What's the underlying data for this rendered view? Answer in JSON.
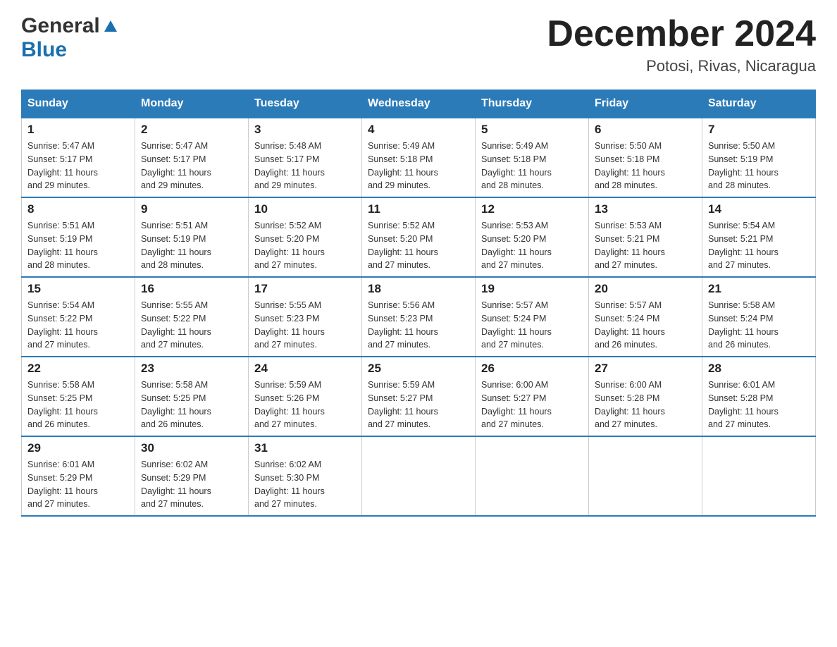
{
  "header": {
    "logo": {
      "general": "General",
      "blue": "Blue",
      "tagline": ""
    },
    "title": "December 2024",
    "location": "Potosi, Rivas, Nicaragua"
  },
  "days_of_week": [
    "Sunday",
    "Monday",
    "Tuesday",
    "Wednesday",
    "Thursday",
    "Friday",
    "Saturday"
  ],
  "weeks": [
    [
      {
        "day": "1",
        "sunrise": "5:47 AM",
        "sunset": "5:17 PM",
        "daylight": "11 hours and 29 minutes."
      },
      {
        "day": "2",
        "sunrise": "5:47 AM",
        "sunset": "5:17 PM",
        "daylight": "11 hours and 29 minutes."
      },
      {
        "day": "3",
        "sunrise": "5:48 AM",
        "sunset": "5:17 PM",
        "daylight": "11 hours and 29 minutes."
      },
      {
        "day": "4",
        "sunrise": "5:49 AM",
        "sunset": "5:18 PM",
        "daylight": "11 hours and 29 minutes."
      },
      {
        "day": "5",
        "sunrise": "5:49 AM",
        "sunset": "5:18 PM",
        "daylight": "11 hours and 28 minutes."
      },
      {
        "day": "6",
        "sunrise": "5:50 AM",
        "sunset": "5:18 PM",
        "daylight": "11 hours and 28 minutes."
      },
      {
        "day": "7",
        "sunrise": "5:50 AM",
        "sunset": "5:19 PM",
        "daylight": "11 hours and 28 minutes."
      }
    ],
    [
      {
        "day": "8",
        "sunrise": "5:51 AM",
        "sunset": "5:19 PM",
        "daylight": "11 hours and 28 minutes."
      },
      {
        "day": "9",
        "sunrise": "5:51 AM",
        "sunset": "5:19 PM",
        "daylight": "11 hours and 28 minutes."
      },
      {
        "day": "10",
        "sunrise": "5:52 AM",
        "sunset": "5:20 PM",
        "daylight": "11 hours and 27 minutes."
      },
      {
        "day": "11",
        "sunrise": "5:52 AM",
        "sunset": "5:20 PM",
        "daylight": "11 hours and 27 minutes."
      },
      {
        "day": "12",
        "sunrise": "5:53 AM",
        "sunset": "5:20 PM",
        "daylight": "11 hours and 27 minutes."
      },
      {
        "day": "13",
        "sunrise": "5:53 AM",
        "sunset": "5:21 PM",
        "daylight": "11 hours and 27 minutes."
      },
      {
        "day": "14",
        "sunrise": "5:54 AM",
        "sunset": "5:21 PM",
        "daylight": "11 hours and 27 minutes."
      }
    ],
    [
      {
        "day": "15",
        "sunrise": "5:54 AM",
        "sunset": "5:22 PM",
        "daylight": "11 hours and 27 minutes."
      },
      {
        "day": "16",
        "sunrise": "5:55 AM",
        "sunset": "5:22 PM",
        "daylight": "11 hours and 27 minutes."
      },
      {
        "day": "17",
        "sunrise": "5:55 AM",
        "sunset": "5:23 PM",
        "daylight": "11 hours and 27 minutes."
      },
      {
        "day": "18",
        "sunrise": "5:56 AM",
        "sunset": "5:23 PM",
        "daylight": "11 hours and 27 minutes."
      },
      {
        "day": "19",
        "sunrise": "5:57 AM",
        "sunset": "5:24 PM",
        "daylight": "11 hours and 27 minutes."
      },
      {
        "day": "20",
        "sunrise": "5:57 AM",
        "sunset": "5:24 PM",
        "daylight": "11 hours and 26 minutes."
      },
      {
        "day": "21",
        "sunrise": "5:58 AM",
        "sunset": "5:24 PM",
        "daylight": "11 hours and 26 minutes."
      }
    ],
    [
      {
        "day": "22",
        "sunrise": "5:58 AM",
        "sunset": "5:25 PM",
        "daylight": "11 hours and 26 minutes."
      },
      {
        "day": "23",
        "sunrise": "5:58 AM",
        "sunset": "5:25 PM",
        "daylight": "11 hours and 26 minutes."
      },
      {
        "day": "24",
        "sunrise": "5:59 AM",
        "sunset": "5:26 PM",
        "daylight": "11 hours and 27 minutes."
      },
      {
        "day": "25",
        "sunrise": "5:59 AM",
        "sunset": "5:27 PM",
        "daylight": "11 hours and 27 minutes."
      },
      {
        "day": "26",
        "sunrise": "6:00 AM",
        "sunset": "5:27 PM",
        "daylight": "11 hours and 27 minutes."
      },
      {
        "day": "27",
        "sunrise": "6:00 AM",
        "sunset": "5:28 PM",
        "daylight": "11 hours and 27 minutes."
      },
      {
        "day": "28",
        "sunrise": "6:01 AM",
        "sunset": "5:28 PM",
        "daylight": "11 hours and 27 minutes."
      }
    ],
    [
      {
        "day": "29",
        "sunrise": "6:01 AM",
        "sunset": "5:29 PM",
        "daylight": "11 hours and 27 minutes."
      },
      {
        "day": "30",
        "sunrise": "6:02 AM",
        "sunset": "5:29 PM",
        "daylight": "11 hours and 27 minutes."
      },
      {
        "day": "31",
        "sunrise": "6:02 AM",
        "sunset": "5:30 PM",
        "daylight": "11 hours and 27 minutes."
      },
      null,
      null,
      null,
      null
    ]
  ],
  "labels": {
    "sunrise": "Sunrise:",
    "sunset": "Sunset:",
    "daylight": "Daylight:"
  }
}
